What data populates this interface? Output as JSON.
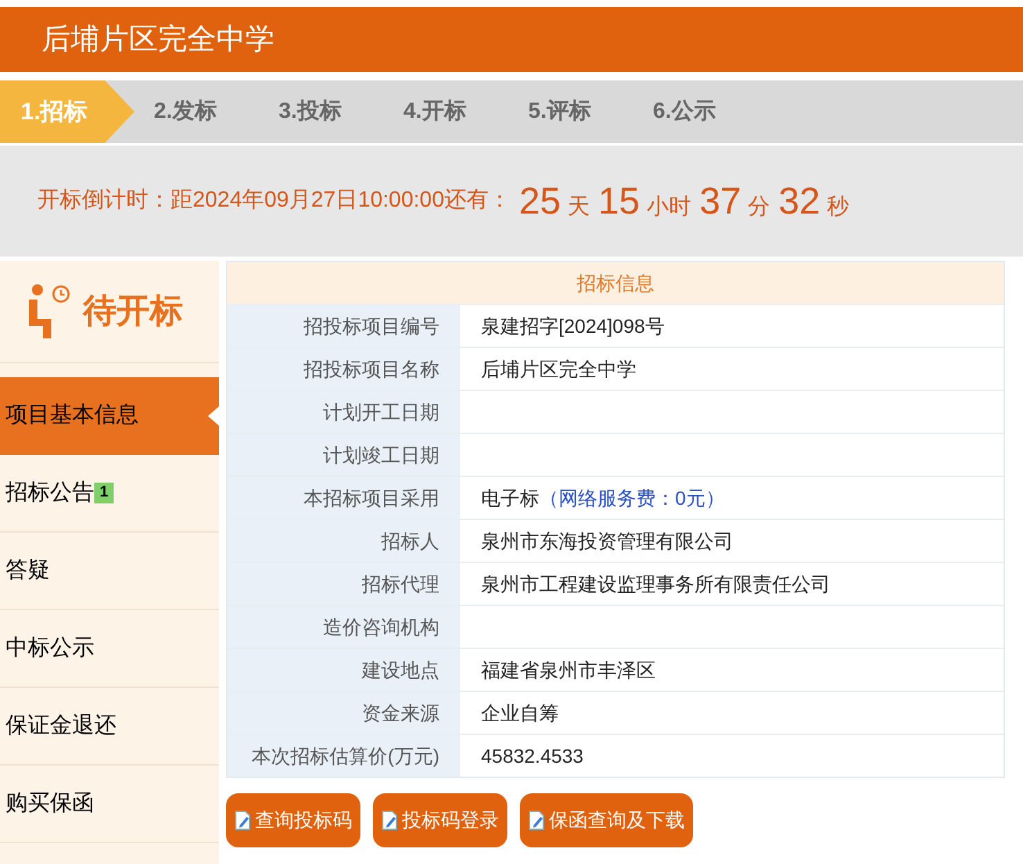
{
  "header": {
    "title": "后埔片区完全中学"
  },
  "steps": [
    {
      "label": "1.招标",
      "selected": true
    },
    {
      "label": "2.发标",
      "selected": false
    },
    {
      "label": "3.投标",
      "selected": false
    },
    {
      "label": "4.开标",
      "selected": false
    },
    {
      "label": "5.评标",
      "selected": false
    },
    {
      "label": "6.公示",
      "selected": false
    }
  ],
  "countdown": {
    "prefix": "开标倒计时：距2024年09月27日10:00:00还有：",
    "parts": [
      {
        "number": "25",
        "unit": "天"
      },
      {
        "number": "15",
        "unit": "小时"
      },
      {
        "number": "37",
        "unit": "分"
      },
      {
        "number": "32",
        "unit": "秒"
      }
    ]
  },
  "sidebar": {
    "status": "待开标",
    "items": [
      {
        "label": "项目基本信息",
        "selected": true
      },
      {
        "label": "招标公告",
        "selected": false,
        "badge": "1"
      },
      {
        "label": "答疑",
        "selected": false
      },
      {
        "label": "中标公示",
        "selected": false
      },
      {
        "label": "保证金退还",
        "selected": false
      },
      {
        "label": "购买保函",
        "selected": false
      }
    ]
  },
  "table": {
    "title": "招标信息",
    "rows": [
      {
        "label": "招投标项目编号",
        "value": "泉建招字[2024]098号"
      },
      {
        "label": "招投标项目名称",
        "value": "后埔片区完全中学"
      },
      {
        "label": "计划开工日期"
      },
      {
        "label": "计划竣工日期"
      },
      {
        "label": "本招标项目采用",
        "value": "电子标",
        "note": "（网络服务费：0元）"
      },
      {
        "label": "招标人",
        "value": "泉州市东海投资管理有限公司"
      },
      {
        "label": "招标代理",
        "value": "泉州市工程建设监理事务所有限责任公司"
      },
      {
        "label": "造价咨询机构"
      },
      {
        "label": "建设地点",
        "value": "福建省泉州市丰泽区"
      },
      {
        "label": "资金来源",
        "value": "企业自筹"
      },
      {
        "label": "本次招标估算价(万元)",
        "value": "45832.4533"
      }
    ]
  },
  "buttons": [
    "查询投标码",
    "投标码登录",
    "保函查询及下载"
  ]
}
